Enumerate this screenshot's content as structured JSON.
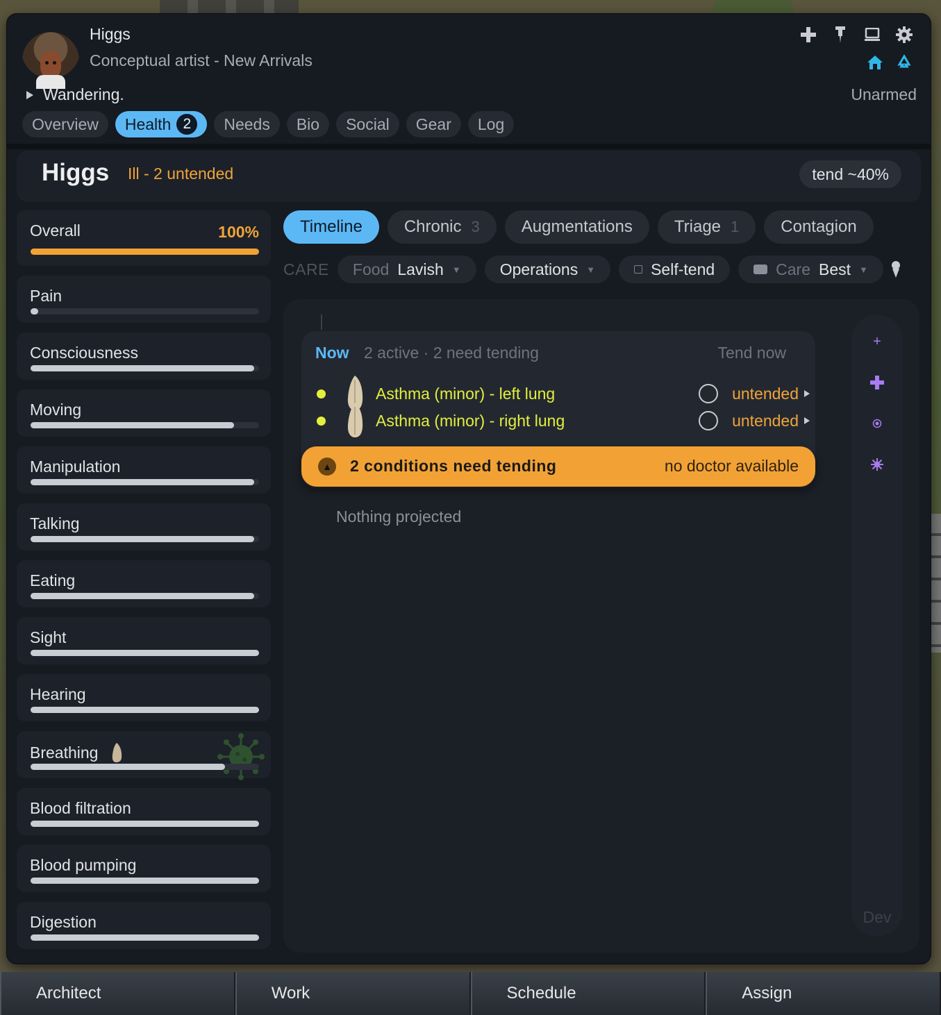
{
  "pawn": {
    "name": "Higgs",
    "title": "Conceptual artist - New Arrivals",
    "status": "Wandering.",
    "weapon": "Unarmed"
  },
  "header_icons": [
    "medical-cross-icon",
    "pin-icon",
    "monitor-icon",
    "gear-icon"
  ],
  "header_subicons": [
    "home-icon",
    "recycle-icon"
  ],
  "tabs": [
    {
      "label": "Overview"
    },
    {
      "label": "Health",
      "badge": "2",
      "active": true
    },
    {
      "label": "Needs"
    },
    {
      "label": "Bio"
    },
    {
      "label": "Social"
    },
    {
      "label": "Gear"
    },
    {
      "label": "Log"
    }
  ],
  "health": {
    "name": "Higgs",
    "status": "Ill - 2 untended",
    "tend": "tend ~40%"
  },
  "capacities": [
    {
      "label": "Overall",
      "pct": "100%",
      "level": 1.0
    },
    {
      "label": "Pain",
      "level": 0.02
    },
    {
      "label": "Consciousness",
      "level": 0.98
    },
    {
      "label": "Moving",
      "level": 0.89
    },
    {
      "label": "Manipulation",
      "level": 0.98
    },
    {
      "label": "Talking",
      "level": 0.98
    },
    {
      "label": "Eating",
      "level": 0.98
    },
    {
      "label": "Sight",
      "level": 1.0
    },
    {
      "label": "Hearing",
      "level": 1.0
    },
    {
      "label": "Breathing",
      "level": 0.85
    },
    {
      "label": "Blood filtration",
      "level": 1.0
    },
    {
      "label": "Blood pumping",
      "level": 1.0
    },
    {
      "label": "Digestion",
      "level": 1.0
    }
  ],
  "subtabs": [
    {
      "label": "Timeline",
      "active": true
    },
    {
      "label": "Chronic",
      "count": "3"
    },
    {
      "label": "Augmentations"
    },
    {
      "label": "Triage",
      "count": "1"
    },
    {
      "label": "Contagion"
    }
  ],
  "care": {
    "label": "CARE",
    "food_label": "Food",
    "food_value": "Lavish",
    "operations": "Operations",
    "selftend": "Self-tend",
    "care_label": "Care",
    "care_value": "Best"
  },
  "timeline": {
    "now": "Now",
    "summary": "2 active · 2 need tending",
    "tend_now": "Tend now",
    "conditions": [
      {
        "name": "Asthma (minor) - left lung",
        "state": "untended"
      },
      {
        "name": "Asthma (minor) - right lung",
        "state": "untended"
      }
    ],
    "alert": "2 conditions need tending",
    "alert_note": "no doctor available",
    "projected": "Nothing projected",
    "dev": "Dev"
  },
  "bottom_bar": [
    "Architect",
    "Work",
    "Schedule",
    "Assign"
  ],
  "colors": {
    "accent": "#5cb8f5",
    "warning": "#f2a234",
    "condition": "#e3ef3e",
    "panel": "#161a21"
  }
}
